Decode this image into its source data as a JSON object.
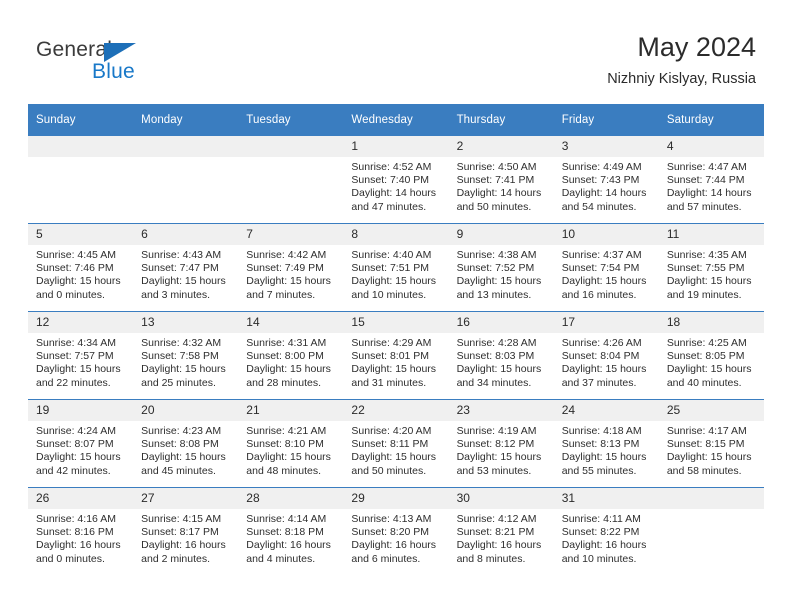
{
  "logo": {
    "primary_text": "General",
    "secondary_text": "Blue",
    "primary_color": "#3b3b3b",
    "secondary_color": "#1878c8",
    "triangle_color": "#1d6fb8"
  },
  "header": {
    "title": "May 2024",
    "subtitle": "Nizhniy Kislyay, Russia"
  },
  "theme": {
    "header_bar_color": "#3a7dc0",
    "daynum_band_color": "#f0f0f0",
    "row_divider_color": "#3a7dc0",
    "text_color": "#2e2e2e"
  },
  "weekday_headers": [
    "Sunday",
    "Monday",
    "Tuesday",
    "Wednesday",
    "Thursday",
    "Friday",
    "Saturday"
  ],
  "weeks": [
    [
      {
        "day": "",
        "empty": true,
        "sunrise": "",
        "sunset": "",
        "daylight_line1": "",
        "daylight_line2": ""
      },
      {
        "day": "",
        "empty": true,
        "sunrise": "",
        "sunset": "",
        "daylight_line1": "",
        "daylight_line2": ""
      },
      {
        "day": "",
        "empty": true,
        "sunrise": "",
        "sunset": "",
        "daylight_line1": "",
        "daylight_line2": ""
      },
      {
        "day": "1",
        "empty": false,
        "sunrise": "Sunrise: 4:52 AM",
        "sunset": "Sunset: 7:40 PM",
        "daylight_line1": "Daylight: 14 hours",
        "daylight_line2": "and 47 minutes."
      },
      {
        "day": "2",
        "empty": false,
        "sunrise": "Sunrise: 4:50 AM",
        "sunset": "Sunset: 7:41 PM",
        "daylight_line1": "Daylight: 14 hours",
        "daylight_line2": "and 50 minutes."
      },
      {
        "day": "3",
        "empty": false,
        "sunrise": "Sunrise: 4:49 AM",
        "sunset": "Sunset: 7:43 PM",
        "daylight_line1": "Daylight: 14 hours",
        "daylight_line2": "and 54 minutes."
      },
      {
        "day": "4",
        "empty": false,
        "sunrise": "Sunrise: 4:47 AM",
        "sunset": "Sunset: 7:44 PM",
        "daylight_line1": "Daylight: 14 hours",
        "daylight_line2": "and 57 minutes."
      }
    ],
    [
      {
        "day": "5",
        "empty": false,
        "sunrise": "Sunrise: 4:45 AM",
        "sunset": "Sunset: 7:46 PM",
        "daylight_line1": "Daylight: 15 hours",
        "daylight_line2": "and 0 minutes."
      },
      {
        "day": "6",
        "empty": false,
        "sunrise": "Sunrise: 4:43 AM",
        "sunset": "Sunset: 7:47 PM",
        "daylight_line1": "Daylight: 15 hours",
        "daylight_line2": "and 3 minutes."
      },
      {
        "day": "7",
        "empty": false,
        "sunrise": "Sunrise: 4:42 AM",
        "sunset": "Sunset: 7:49 PM",
        "daylight_line1": "Daylight: 15 hours",
        "daylight_line2": "and 7 minutes."
      },
      {
        "day": "8",
        "empty": false,
        "sunrise": "Sunrise: 4:40 AM",
        "sunset": "Sunset: 7:51 PM",
        "daylight_line1": "Daylight: 15 hours",
        "daylight_line2": "and 10 minutes."
      },
      {
        "day": "9",
        "empty": false,
        "sunrise": "Sunrise: 4:38 AM",
        "sunset": "Sunset: 7:52 PM",
        "daylight_line1": "Daylight: 15 hours",
        "daylight_line2": "and 13 minutes."
      },
      {
        "day": "10",
        "empty": false,
        "sunrise": "Sunrise: 4:37 AM",
        "sunset": "Sunset: 7:54 PM",
        "daylight_line1": "Daylight: 15 hours",
        "daylight_line2": "and 16 minutes."
      },
      {
        "day": "11",
        "empty": false,
        "sunrise": "Sunrise: 4:35 AM",
        "sunset": "Sunset: 7:55 PM",
        "daylight_line1": "Daylight: 15 hours",
        "daylight_line2": "and 19 minutes."
      }
    ],
    [
      {
        "day": "12",
        "empty": false,
        "sunrise": "Sunrise: 4:34 AM",
        "sunset": "Sunset: 7:57 PM",
        "daylight_line1": "Daylight: 15 hours",
        "daylight_line2": "and 22 minutes."
      },
      {
        "day": "13",
        "empty": false,
        "sunrise": "Sunrise: 4:32 AM",
        "sunset": "Sunset: 7:58 PM",
        "daylight_line1": "Daylight: 15 hours",
        "daylight_line2": "and 25 minutes."
      },
      {
        "day": "14",
        "empty": false,
        "sunrise": "Sunrise: 4:31 AM",
        "sunset": "Sunset: 8:00 PM",
        "daylight_line1": "Daylight: 15 hours",
        "daylight_line2": "and 28 minutes."
      },
      {
        "day": "15",
        "empty": false,
        "sunrise": "Sunrise: 4:29 AM",
        "sunset": "Sunset: 8:01 PM",
        "daylight_line1": "Daylight: 15 hours",
        "daylight_line2": "and 31 minutes."
      },
      {
        "day": "16",
        "empty": false,
        "sunrise": "Sunrise: 4:28 AM",
        "sunset": "Sunset: 8:03 PM",
        "daylight_line1": "Daylight: 15 hours",
        "daylight_line2": "and 34 minutes."
      },
      {
        "day": "17",
        "empty": false,
        "sunrise": "Sunrise: 4:26 AM",
        "sunset": "Sunset: 8:04 PM",
        "daylight_line1": "Daylight: 15 hours",
        "daylight_line2": "and 37 minutes."
      },
      {
        "day": "18",
        "empty": false,
        "sunrise": "Sunrise: 4:25 AM",
        "sunset": "Sunset: 8:05 PM",
        "daylight_line1": "Daylight: 15 hours",
        "daylight_line2": "and 40 minutes."
      }
    ],
    [
      {
        "day": "19",
        "empty": false,
        "sunrise": "Sunrise: 4:24 AM",
        "sunset": "Sunset: 8:07 PM",
        "daylight_line1": "Daylight: 15 hours",
        "daylight_line2": "and 42 minutes."
      },
      {
        "day": "20",
        "empty": false,
        "sunrise": "Sunrise: 4:23 AM",
        "sunset": "Sunset: 8:08 PM",
        "daylight_line1": "Daylight: 15 hours",
        "daylight_line2": "and 45 minutes."
      },
      {
        "day": "21",
        "empty": false,
        "sunrise": "Sunrise: 4:21 AM",
        "sunset": "Sunset: 8:10 PM",
        "daylight_line1": "Daylight: 15 hours",
        "daylight_line2": "and 48 minutes."
      },
      {
        "day": "22",
        "empty": false,
        "sunrise": "Sunrise: 4:20 AM",
        "sunset": "Sunset: 8:11 PM",
        "daylight_line1": "Daylight: 15 hours",
        "daylight_line2": "and 50 minutes."
      },
      {
        "day": "23",
        "empty": false,
        "sunrise": "Sunrise: 4:19 AM",
        "sunset": "Sunset: 8:12 PM",
        "daylight_line1": "Daylight: 15 hours",
        "daylight_line2": "and 53 minutes."
      },
      {
        "day": "24",
        "empty": false,
        "sunrise": "Sunrise: 4:18 AM",
        "sunset": "Sunset: 8:13 PM",
        "daylight_line1": "Daylight: 15 hours",
        "daylight_line2": "and 55 minutes."
      },
      {
        "day": "25",
        "empty": false,
        "sunrise": "Sunrise: 4:17 AM",
        "sunset": "Sunset: 8:15 PM",
        "daylight_line1": "Daylight: 15 hours",
        "daylight_line2": "and 58 minutes."
      }
    ],
    [
      {
        "day": "26",
        "empty": false,
        "sunrise": "Sunrise: 4:16 AM",
        "sunset": "Sunset: 8:16 PM",
        "daylight_line1": "Daylight: 16 hours",
        "daylight_line2": "and 0 minutes."
      },
      {
        "day": "27",
        "empty": false,
        "sunrise": "Sunrise: 4:15 AM",
        "sunset": "Sunset: 8:17 PM",
        "daylight_line1": "Daylight: 16 hours",
        "daylight_line2": "and 2 minutes."
      },
      {
        "day": "28",
        "empty": false,
        "sunrise": "Sunrise: 4:14 AM",
        "sunset": "Sunset: 8:18 PM",
        "daylight_line1": "Daylight: 16 hours",
        "daylight_line2": "and 4 minutes."
      },
      {
        "day": "29",
        "empty": false,
        "sunrise": "Sunrise: 4:13 AM",
        "sunset": "Sunset: 8:20 PM",
        "daylight_line1": "Daylight: 16 hours",
        "daylight_line2": "and 6 minutes."
      },
      {
        "day": "30",
        "empty": false,
        "sunrise": "Sunrise: 4:12 AM",
        "sunset": "Sunset: 8:21 PM",
        "daylight_line1": "Daylight: 16 hours",
        "daylight_line2": "and 8 minutes."
      },
      {
        "day": "31",
        "empty": false,
        "sunrise": "Sunrise: 4:11 AM",
        "sunset": "Sunset: 8:22 PM",
        "daylight_line1": "Daylight: 16 hours",
        "daylight_line2": "and 10 minutes."
      },
      {
        "day": "",
        "empty": true,
        "sunrise": "",
        "sunset": "",
        "daylight_line1": "",
        "daylight_line2": ""
      }
    ]
  ]
}
